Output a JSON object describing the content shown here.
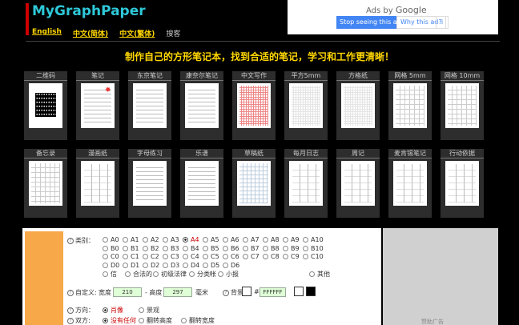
{
  "header": {
    "logo": "MyGraphPaper",
    "languages": [
      "English",
      "中文(简体)",
      "中文(繁体)"
    ],
    "link": "搜客"
  },
  "ad": {
    "ads_by": "Ads by",
    "google": "Google",
    "stop_btn": "Stop seeing this ad",
    "why_btn": "Why this ad?",
    "info_icon": "i"
  },
  "headline": "制作自己的方形笔记本，找到合适的笔记，学习和工作更清晰！",
  "papers_row1": [
    {
      "label": "二维码",
      "icon": "qr-code"
    },
    {
      "label": "笔记",
      "icon": "lined"
    },
    {
      "label": "东京笔记",
      "icon": "lined"
    },
    {
      "label": "康奈尔笔记",
      "icon": "cornell"
    },
    {
      "label": "中文写作",
      "icon": "grid-red"
    },
    {
      "label": "平方5mm",
      "icon": "grid-small"
    },
    {
      "label": "方格纸",
      "icon": "grid-small"
    },
    {
      "label": "网格 5mm",
      "icon": "grid-medium"
    },
    {
      "label": "网格 10mm",
      "icon": "grid-medium"
    }
  ],
  "papers_row2": [
    {
      "label": "备忘录",
      "icon": "memo"
    },
    {
      "label": "漫画纸",
      "icon": "comic"
    },
    {
      "label": "字母练习",
      "icon": "lined"
    },
    {
      "label": "乐谱",
      "icon": "staff"
    },
    {
      "label": "草稿纸",
      "icon": "grid-blue"
    },
    {
      "label": "每月日志",
      "icon": "calendar"
    },
    {
      "label": "周记",
      "icon": "weekly"
    },
    {
      "label": "麦肯锡笔记",
      "icon": "columns"
    },
    {
      "label": "行动依据",
      "icon": "columns"
    }
  ],
  "form": {
    "type_label": "类别：",
    "sizes": [
      [
        "A0",
        "A1",
        "A2",
        "A3",
        "A4",
        "A5",
        "A6",
        "A7",
        "A8",
        "A9",
        "A10"
      ],
      [
        "B0",
        "B1",
        "B2",
        "B3",
        "B4",
        "B5",
        "B6",
        "B7",
        "B8",
        "B9",
        "B10"
      ],
      [
        "C0",
        "C1",
        "C2",
        "C3",
        "C4",
        "C5",
        "C6",
        "C7",
        "C8",
        "C9",
        "C10"
      ],
      [
        "D0",
        "D1",
        "D2",
        "D3",
        "D4",
        "D5",
        "D6"
      ]
    ],
    "selected_size": "A4",
    "extra_sizes": [
      "信",
      "合法的",
      "初级法律",
      "分类帐",
      "小报"
    ],
    "other": "其他",
    "custom_label": "自定义:",
    "width_label": "宽度",
    "width_value": "210",
    "height_label": "- 高度",
    "height_value": "297",
    "unit": "毫米",
    "bg_label": "背景",
    "hash": "#",
    "color_value": "FFFFFF",
    "orientation_label": "方向：",
    "portrait": "肖像",
    "landscape": "景观",
    "duplex_label": "双方:",
    "duplex_none": "没有任何",
    "duplex_flip_height": "翻转高度",
    "duplex_flip_width": "翻转宽度"
  },
  "side_ad": {
    "label": "赞助广告"
  },
  "colors": {
    "accent": "#ffd700",
    "logo": "#2ec8d8",
    "selected": "#cc0000",
    "orange": "#f7a849"
  }
}
